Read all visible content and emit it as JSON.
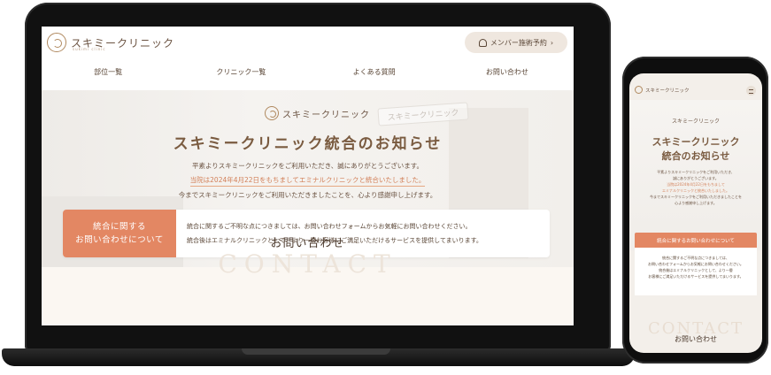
{
  "laptop": {
    "logo_text": "スキミークリニック",
    "logo_sub": "sukimi clinic",
    "member_button": "メンバー施術予約",
    "member_arrow": "›",
    "nav": [
      "部位一覧",
      "クリニック一覧",
      "よくある質問",
      "お問い合わせ"
    ],
    "hero": {
      "logo_text": "スキミークリニック",
      "sign_text": "スキミークリニック",
      "title": "スキミークリニック統合のお知らせ",
      "line1": "平素よりスキミークリニックをご利用いただき、誠にありがとうございます。",
      "line2": "当院は2024年4月22日をもちましてエミナルクリニックと統合いたしました。",
      "line3": "今までスキミークリニックをご利用いただきましたことを、心より感謝申し上げます。"
    },
    "notice": {
      "label_line1": "統合に関する",
      "label_line2": "お問い合わせについて",
      "body_line1": "統合に関するご不明な点につきましては、お問い合わせフォームからお気軽にお問い合わせください。",
      "body_line2": "統合後はエミナルクリニックとして、より一層お客様にご満足いただけるサービスを提供してまいります。"
    },
    "contact_title": "お問い合わせ",
    "contact_bg": "CONTACT"
  },
  "phone": {
    "logo_text": "スキミークリニック",
    "hero_logo": "スキミークリニック",
    "title_line1": "スキミークリニック",
    "title_line2": "統合のお知らせ",
    "line1": "平素よりスキミークリニックをご利用いただき、",
    "line2": "誠にありがとうございます。",
    "line3": "当院は2024年4月22日をもちまして",
    "line4": "エミナルクリニックと統合いたしました。",
    "line5": "今までスキミークリニックをご利用いただきましたことを",
    "line6": "心より感謝申し上げます。",
    "notice_header": "統合に関するお問い合わせについて",
    "notice_body1": "統合に関するご不明な点につきましては、",
    "notice_body2": "お問い合わせフォームからお気軽にお問い合わせください。",
    "notice_body3": "統合後はエミナルクリニックとして、より一層",
    "notice_body4": "お客様にご満足いただけるサービスを提供してまいります。",
    "contact_bg": "CONTACT",
    "contact_title": "お問い合わせ"
  },
  "colors": {
    "accent": "#e38763",
    "brown": "#7a5b40",
    "background": "#fbf7f2"
  }
}
